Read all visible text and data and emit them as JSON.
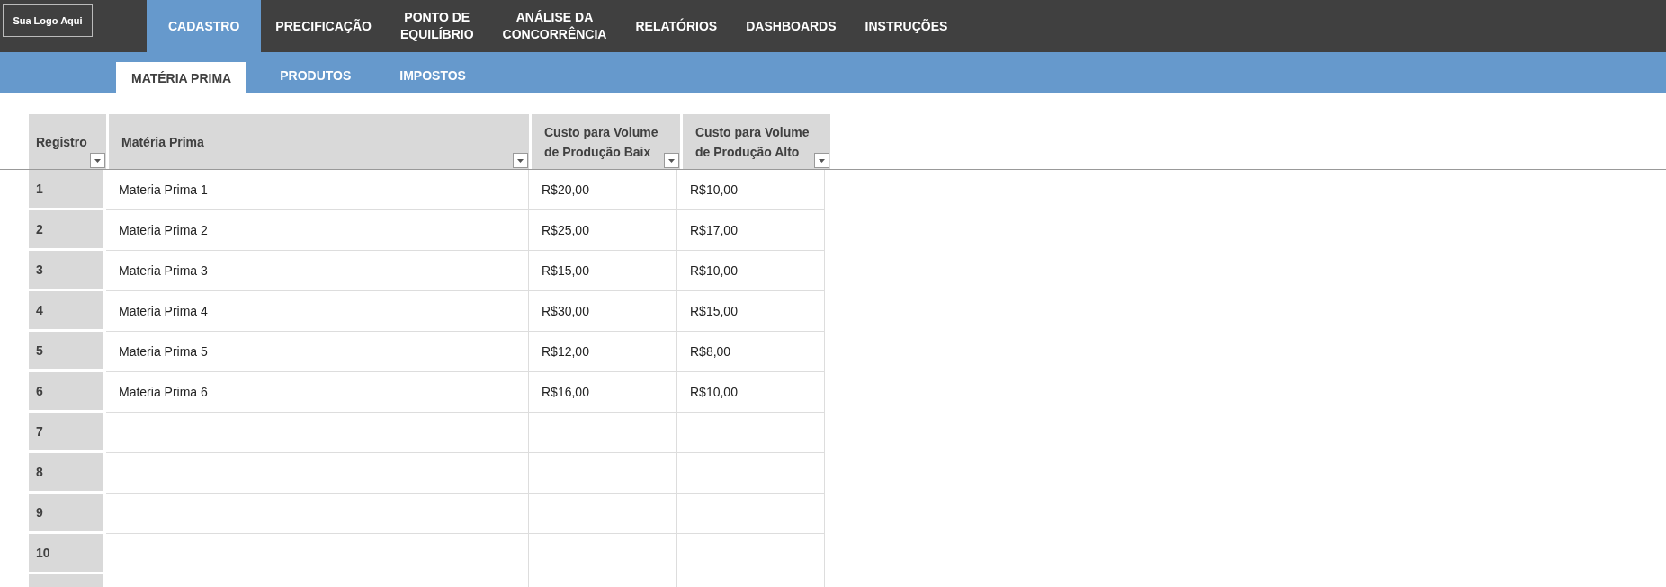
{
  "logo": "Sua Logo Aqui",
  "nav": [
    {
      "label": "CADASTRO",
      "selected": true
    },
    {
      "label": "PRECIFICAÇÃO",
      "selected": false
    },
    {
      "label": "PONTO DE\nEQUILÍBRIO",
      "selected": false
    },
    {
      "label": "ANÁLISE DA\nCONCORRÊNCIA",
      "selected": false
    },
    {
      "label": "RELATÓRIOS",
      "selected": false
    },
    {
      "label": "DASHBOARDS",
      "selected": false
    },
    {
      "label": "INSTRUÇÕES",
      "selected": false
    }
  ],
  "subtabs": [
    {
      "label": "MATÉRIA PRIMA",
      "selected": true
    },
    {
      "label": "PRODUTOS",
      "selected": false
    },
    {
      "label": "IMPOSTOS",
      "selected": false
    }
  ],
  "table": {
    "columns": [
      "Registro",
      "Matéria Prima",
      "Custo para Volume de Produção Baix",
      "Custo para Volume de Produção Alto"
    ],
    "rows": [
      {
        "registro": "1",
        "materia": "Materia Prima 1",
        "baixo": "R$20,00",
        "alto": "R$10,00"
      },
      {
        "registro": "2",
        "materia": "Materia Prima 2",
        "baixo": "R$25,00",
        "alto": "R$17,00"
      },
      {
        "registro": "3",
        "materia": "Materia Prima 3",
        "baixo": "R$15,00",
        "alto": "R$10,00"
      },
      {
        "registro": "4",
        "materia": "Materia Prima 4",
        "baixo": "R$30,00",
        "alto": "R$15,00"
      },
      {
        "registro": "5",
        "materia": "Materia Prima 5",
        "baixo": "R$12,00",
        "alto": "R$8,00"
      },
      {
        "registro": "6",
        "materia": "Materia Prima 6",
        "baixo": "R$16,00",
        "alto": "R$10,00"
      },
      {
        "registro": "7"
      },
      {
        "registro": "8"
      },
      {
        "registro": "9"
      },
      {
        "registro": "10"
      }
    ]
  }
}
